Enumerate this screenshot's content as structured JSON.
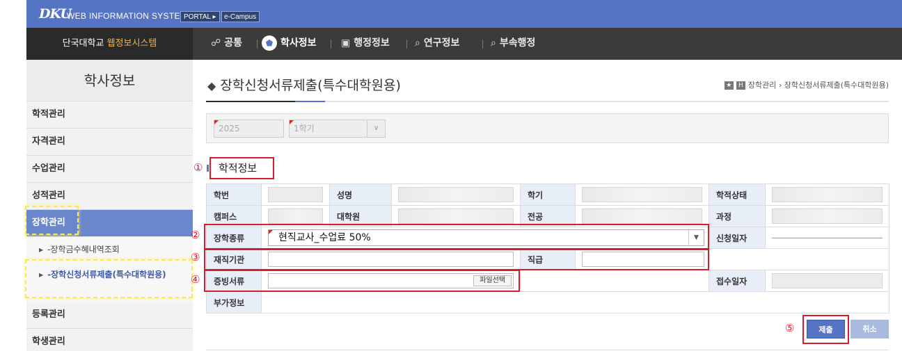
{
  "topbar": {
    "logo": "DKU",
    "system_name": "WEB INFORMATION SYSTEM",
    "portal_label": "PORTAL ▸",
    "ecampus_label": "e-Campus"
  },
  "navbar": {
    "brand_prefix": "단국대학교 ",
    "brand_accent": "웹정보시스템",
    "items": [
      {
        "label": "공통",
        "icon": "share-icon"
      },
      {
        "label": "학사정보",
        "icon": "tag-icon",
        "active": true
      },
      {
        "label": "행정정보",
        "icon": "inbox-icon"
      },
      {
        "label": "연구정보",
        "icon": "search-icon"
      },
      {
        "label": "부속행정",
        "icon": "search-icon"
      }
    ]
  },
  "sidebar": {
    "title": "학사정보",
    "items": [
      "학적관리",
      "자격관리",
      "수업관리",
      "성적관리",
      "장학관리"
    ],
    "sub_items": [
      "-장학금수혜내역조회",
      "-장학신청서류제출(특수대학원용)"
    ],
    "items_after": [
      "등록관리",
      "학생관리"
    ]
  },
  "page": {
    "title": "장학신청서류제출(특수대학원용)",
    "breadcrumb": [
      "장학관리",
      "장학신청서류제출(특수대학원용)"
    ]
  },
  "filter": {
    "year": "2025",
    "semester": "1학기"
  },
  "section": {
    "title": "학적정보"
  },
  "markers": [
    "①",
    "②",
    "③",
    "④",
    "⑤"
  ],
  "form": {
    "labels": {
      "student_no": "학번",
      "name": "성명",
      "semester": "학기",
      "status": "학적상태",
      "campus": "캠퍼스",
      "graduate_school": "대학원",
      "major": "전공",
      "course": "과정",
      "scholarship_type": "장학종류",
      "apply_date": "신청일자",
      "employer": "재직기관",
      "position": "직급",
      "documents": "증빙서류",
      "receipt_date": "접수일자",
      "extra_info": "부가정보"
    },
    "scholarship_type_value": "현직교사_수업료 50%",
    "file_button": "파일선택"
  },
  "buttons": {
    "submit": "제출",
    "cancel": "취소"
  },
  "colors": {
    "primary": "#5674c4",
    "highlight_red": "#d91c2c",
    "highlight_yellow": "#ffe84d"
  }
}
